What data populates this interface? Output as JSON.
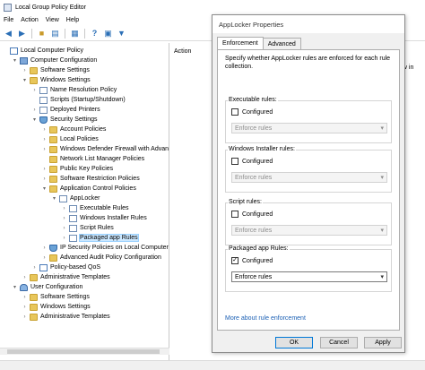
{
  "window": {
    "title": "Local Group Policy Editor"
  },
  "menu": [
    "File",
    "Action",
    "View",
    "Help"
  ],
  "tree": [
    {
      "label": "Local Computer Policy",
      "icon": "chart",
      "indent": 0,
      "tw": ""
    },
    {
      "label": "Computer Configuration",
      "icon": "comp",
      "indent": 1,
      "tw": "▾"
    },
    {
      "label": "Software Settings",
      "icon": "folder",
      "indent": 2,
      "tw": "›"
    },
    {
      "label": "Windows Settings",
      "icon": "folder",
      "indent": 2,
      "tw": "▾"
    },
    {
      "label": "Name Resolution Policy",
      "icon": "doc",
      "indent": 3,
      "tw": "›"
    },
    {
      "label": "Scripts (Startup/Shutdown)",
      "icon": "doc",
      "indent": 3,
      "tw": ""
    },
    {
      "label": "Deployed Printers",
      "icon": "doc",
      "indent": 3,
      "tw": "›"
    },
    {
      "label": "Security Settings",
      "icon": "shield",
      "indent": 3,
      "tw": "▾"
    },
    {
      "label": "Account Policies",
      "icon": "folder",
      "indent": 4,
      "tw": "›"
    },
    {
      "label": "Local Policies",
      "icon": "folder",
      "indent": 4,
      "tw": "›"
    },
    {
      "label": "Windows Defender Firewall with Advan",
      "icon": "folder",
      "indent": 4,
      "tw": "›"
    },
    {
      "label": "Network List Manager Policies",
      "icon": "folder",
      "indent": 4,
      "tw": ""
    },
    {
      "label": "Public Key Policies",
      "icon": "folder",
      "indent": 4,
      "tw": "›"
    },
    {
      "label": "Software Restriction Policies",
      "icon": "folder",
      "indent": 4,
      "tw": "›"
    },
    {
      "label": "Application Control Policies",
      "icon": "folder",
      "indent": 4,
      "tw": "▾"
    },
    {
      "label": "AppLocker",
      "icon": "doc",
      "indent": 5,
      "tw": "▾"
    },
    {
      "label": "Executable Rules",
      "icon": "doc",
      "indent": 6,
      "tw": "›"
    },
    {
      "label": "Windows Installer Rules",
      "icon": "doc",
      "indent": 6,
      "tw": "›"
    },
    {
      "label": "Script Rules",
      "icon": "doc",
      "indent": 6,
      "tw": "›"
    },
    {
      "label": "Packaged app Rules",
      "icon": "doc",
      "indent": 6,
      "tw": "›",
      "selected": true
    },
    {
      "label": "IP Security Policies on Local Computer",
      "icon": "shield",
      "indent": 4,
      "tw": "›"
    },
    {
      "label": "Advanced Audit Policy Configuration",
      "icon": "folder",
      "indent": 4,
      "tw": "›"
    },
    {
      "label": "Policy-based QoS",
      "icon": "chart",
      "indent": 3,
      "tw": "›"
    },
    {
      "label": "Administrative Templates",
      "icon": "folder",
      "indent": 2,
      "tw": "›"
    },
    {
      "label": "User Configuration",
      "icon": "user",
      "indent": 1,
      "tw": "▾"
    },
    {
      "label": "Software Settings",
      "icon": "folder",
      "indent": 2,
      "tw": "›"
    },
    {
      "label": "Windows Settings",
      "icon": "folder",
      "indent": 2,
      "tw": "›"
    },
    {
      "label": "Administrative Templates",
      "icon": "folder",
      "indent": 2,
      "tw": "›"
    }
  ],
  "right_pane": {
    "column_header": "Action",
    "background_text": "ow in"
  },
  "dialog": {
    "title": "AppLocker Properties",
    "tabs": [
      "Enforcement",
      "Advanced"
    ],
    "description": "Specify whether AppLocker rules are enforced for each rule collection.",
    "groups": [
      {
        "label": "Executable rules:",
        "checkbox_label": "Configured",
        "checked": false,
        "select_value": "Enforce rules"
      },
      {
        "label": "Windows Installer rules:",
        "checkbox_label": "Configured",
        "checked": false,
        "select_value": "Enforce rules"
      },
      {
        "label": "Script rules:",
        "checkbox_label": "Configured",
        "checked": false,
        "select_value": "Enforce rules"
      },
      {
        "label": "Packaged app Rules:",
        "checkbox_label": "Configured",
        "checked": true,
        "select_value": "Enforce rules"
      }
    ],
    "link": "More about rule enforcement",
    "buttons": {
      "ok": "OK",
      "cancel": "Cancel",
      "apply": "Apply"
    }
  }
}
